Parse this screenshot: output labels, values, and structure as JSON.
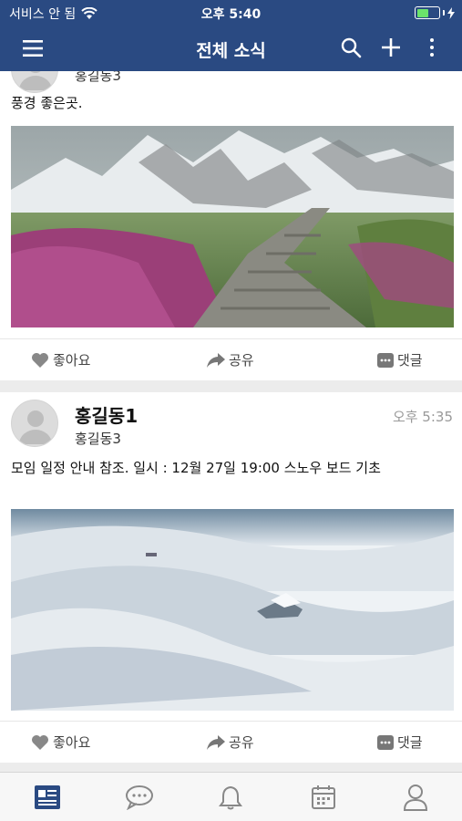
{
  "status_bar": {
    "carrier": "서비스 안 됨",
    "time": "오후 5:40"
  },
  "header": {
    "title": "전체 소식"
  },
  "posts": [
    {
      "group": "홍길동3",
      "text": "풍경 좋은곳.",
      "image": "mountain-path-photo",
      "actions": {
        "like": "좋아요",
        "share": "공유",
        "comment": "댓글"
      }
    },
    {
      "author": "홍길동1",
      "group": "홍길동3",
      "time": "오후 5:35",
      "text": "모임 일정 안내 참조.  일시 : 12월 27일 19:00  스노우 보드 기초",
      "image": "snowy-hills-photo",
      "actions": {
        "like": "좋아요",
        "share": "공유",
        "comment": "댓글"
      }
    }
  ],
  "tab_bar": {
    "items": [
      "feed-icon",
      "chat-icon",
      "bell-icon",
      "calendar-icon",
      "person-icon"
    ],
    "active_index": 0
  },
  "colors": {
    "brand": "#2a4a82",
    "active_tab": "#2a4a82",
    "inactive_tab": "#888888"
  }
}
